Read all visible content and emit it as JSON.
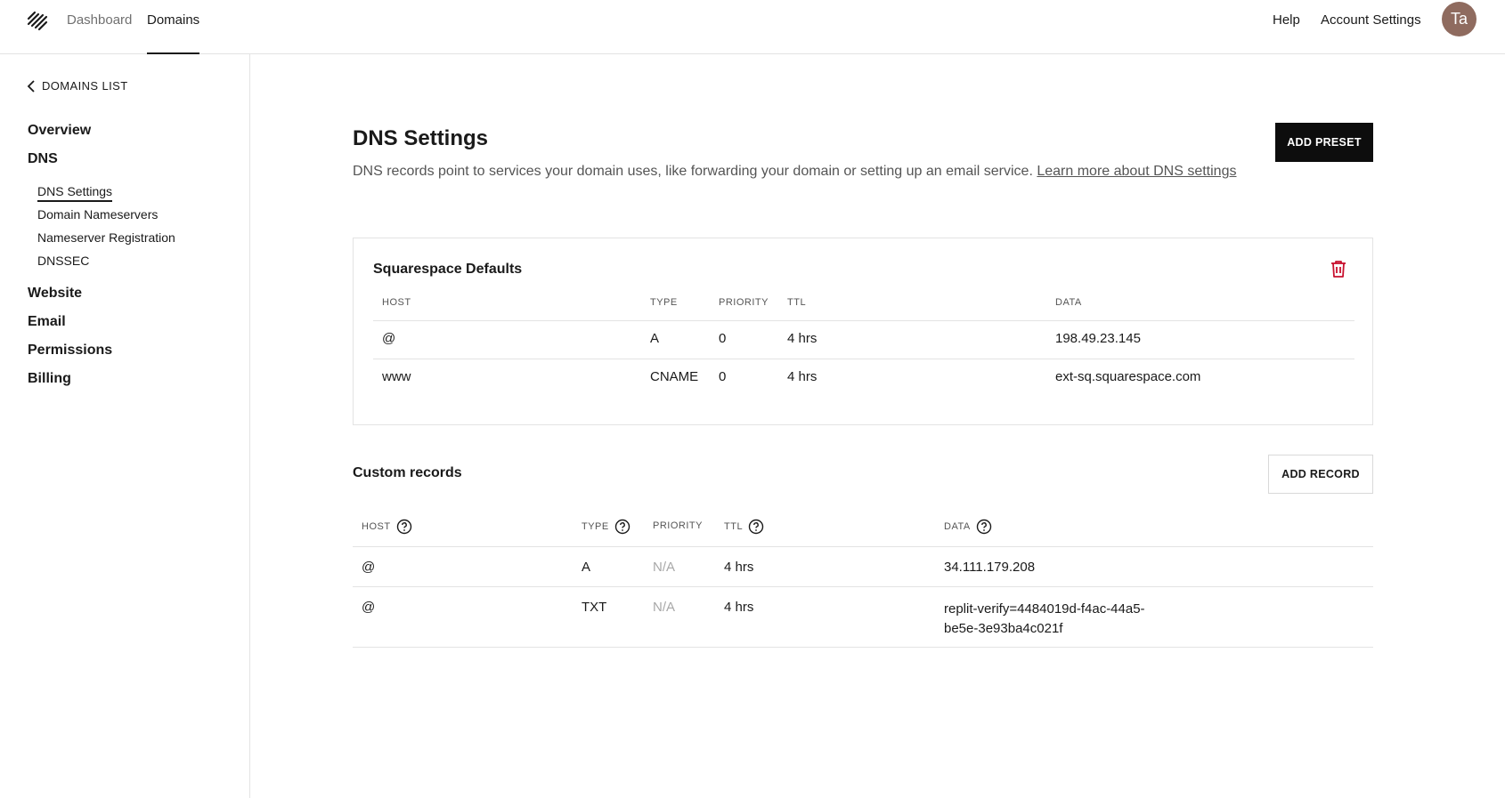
{
  "topbar": {
    "nav": {
      "dashboard": "Dashboard",
      "domains": "Domains"
    },
    "help": "Help",
    "account_settings": "Account Settings",
    "avatar_initials": "Ta",
    "avatar_color": "#8f6b5f"
  },
  "sidebar": {
    "back_label": "DOMAINS LIST",
    "items": {
      "overview": "Overview",
      "dns": "DNS",
      "website": "Website",
      "email": "Email",
      "permissions": "Permissions",
      "billing": "Billing"
    },
    "dns_subitems": {
      "dns_settings": "DNS Settings",
      "domain_nameservers": "Domain Nameservers",
      "nameserver_registration": "Nameserver Registration",
      "dnssec": "DNSSEC"
    }
  },
  "main": {
    "title": "DNS Settings",
    "description": "DNS records point to services your domain uses, like forwarding your domain or setting up an email service.",
    "learn_more": "Learn more about DNS settings",
    "add_preset": "ADD PRESET",
    "defaults": {
      "title": "Squarespace Defaults",
      "headers": {
        "host": "HOST",
        "type": "TYPE",
        "priority": "PRIORITY",
        "ttl": "TTL",
        "data": "DATA"
      },
      "rows": [
        {
          "host": "@",
          "type": "A",
          "priority": "0",
          "ttl": "4 hrs",
          "data": "198.49.23.145"
        },
        {
          "host": "www",
          "type": "CNAME",
          "priority": "0",
          "ttl": "4 hrs",
          "data": "ext-sq.squarespace.com"
        }
      ]
    },
    "custom": {
      "title": "Custom records",
      "add_record": "ADD RECORD",
      "headers": {
        "host": "HOST",
        "type": "TYPE",
        "priority": "PRIORITY",
        "ttl": "TTL",
        "data": "DATA"
      },
      "rows": [
        {
          "host": "@",
          "type": "A",
          "priority": "N/A",
          "ttl": "4 hrs",
          "data": "34.111.179.208"
        },
        {
          "host": "@",
          "type": "TXT",
          "priority": "N/A",
          "ttl": "4 hrs",
          "data_line1": "replit-verify=4484019d-f4ac-44a5-",
          "data_line2": "be5e-3e93ba4c021f"
        }
      ]
    },
    "colors": {
      "delete": "#c8102e",
      "primary_button": "#0d0d0d"
    }
  }
}
